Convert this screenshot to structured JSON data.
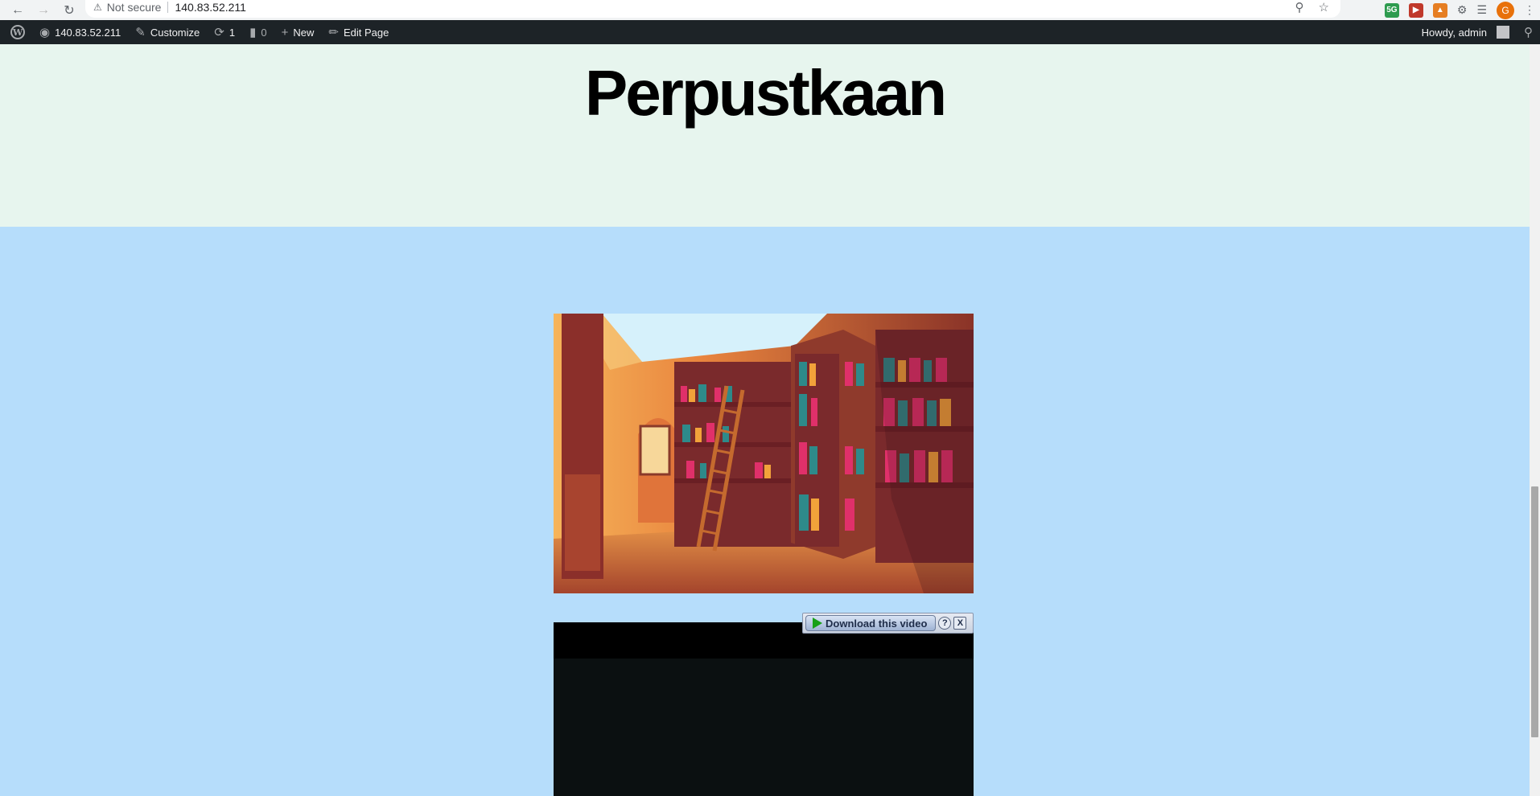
{
  "browser": {
    "security_label": "Not secure",
    "url": "140.83.52.211",
    "profile_initial": "G",
    "extension_badge": "5G"
  },
  "adminbar": {
    "site_name": "140.83.52.211",
    "customize_label": "Customize",
    "updates_count": "1",
    "comments_count": "0",
    "new_label": "New",
    "edit_page_label": "Edit Page",
    "howdy_label": "Howdy, admin"
  },
  "page": {
    "site_title": "Perpustkaan",
    "header_bg": "#e7f5ee",
    "content_bg": "#b6ddfb"
  },
  "video_helper": {
    "download_label": "Download this video",
    "help_label": "?",
    "close_label": "X"
  }
}
